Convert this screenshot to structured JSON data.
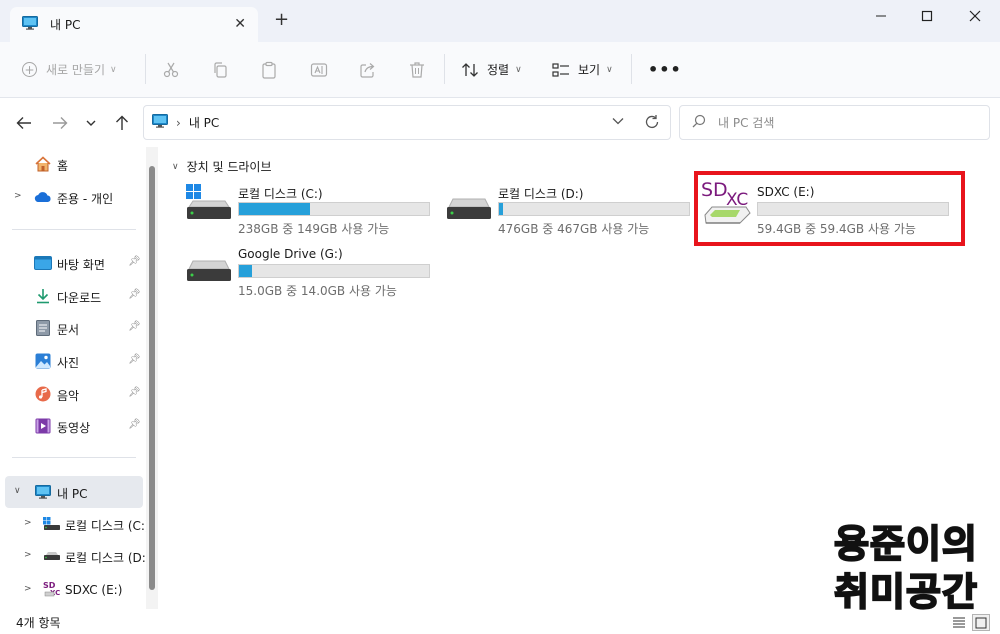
{
  "window": {
    "tab_title": "내 PC",
    "icons": {
      "tab": "monitor-icon",
      "close_tab": "close-icon",
      "new_tab": "plus-icon",
      "minimize": "minimize-icon",
      "maximize": "maximize-icon",
      "close": "close-icon"
    }
  },
  "toolbar": {
    "new_label": "새로 만들기",
    "sort_label": "정렬",
    "view_label": "보기",
    "more_label": "•••",
    "icons": [
      "cut-icon",
      "copy-icon",
      "paste-icon",
      "rename-icon",
      "share-icon",
      "delete-icon"
    ]
  },
  "nav": {
    "address_text": "내 PC",
    "address_separator": "›",
    "search_placeholder": "내 PC 검색"
  },
  "sidebar": {
    "items": [
      {
        "label": "홈",
        "icon": "home-icon"
      },
      {
        "label": "준용 - 개인",
        "icon": "onedrive-cloud-icon"
      },
      {
        "label": "바탕 화면",
        "icon": "desktop-icon",
        "pinned": true
      },
      {
        "label": "다운로드",
        "icon": "download-icon",
        "pinned": true
      },
      {
        "label": "문서",
        "icon": "document-icon",
        "pinned": true
      },
      {
        "label": "사진",
        "icon": "pictures-icon",
        "pinned": true
      },
      {
        "label": "음악",
        "icon": "music-icon",
        "pinned": true
      },
      {
        "label": "동영상",
        "icon": "video-icon",
        "pinned": true
      },
      {
        "label": "내 PC",
        "icon": "monitor-icon",
        "selected": true
      },
      {
        "label": "로컬 디스크 (C:)",
        "icon": "windows-drive-icon"
      },
      {
        "label": "로컬 디스크 (D:)",
        "icon": "drive-icon"
      },
      {
        "label": "SDXC (E:)",
        "icon": "sdxc-card-icon"
      }
    ]
  },
  "content": {
    "section_title": "장치 및 드라이브",
    "drives": [
      {
        "name": "로컬 디스크 (C:)",
        "capacity": "238GB 중 149GB 사용 가능",
        "used_fraction": 0.374,
        "icon": "windows-drive-icon"
      },
      {
        "name": "로컬 디스크 (D:)",
        "capacity": "476GB 중 467GB 사용 가능",
        "used_fraction": 0.019,
        "icon": "drive-icon"
      },
      {
        "name": "SDXC (E:)",
        "capacity": "59.4GB 중 59.4GB 사용 가능",
        "used_fraction": 0.0,
        "icon": "sdxc-card-icon",
        "icon_text": {
          "sd": "SD",
          "xc": "XC"
        }
      },
      {
        "name": "Google Drive (G:)",
        "capacity": "15.0GB 중 14.0GB 사용 가능",
        "used_fraction": 0.067,
        "icon": "drive-icon"
      }
    ]
  },
  "status": {
    "item_count": "4개 항목",
    "icons": [
      "details-view-icon",
      "tiles-view-icon"
    ]
  },
  "watermark": {
    "line1": "용준이의",
    "line2": "취미공간"
  },
  "colors": {
    "progress_fill": "#26a0da",
    "highlight_border": "#e8141c",
    "sdxc_text": "#7b1a7d"
  }
}
